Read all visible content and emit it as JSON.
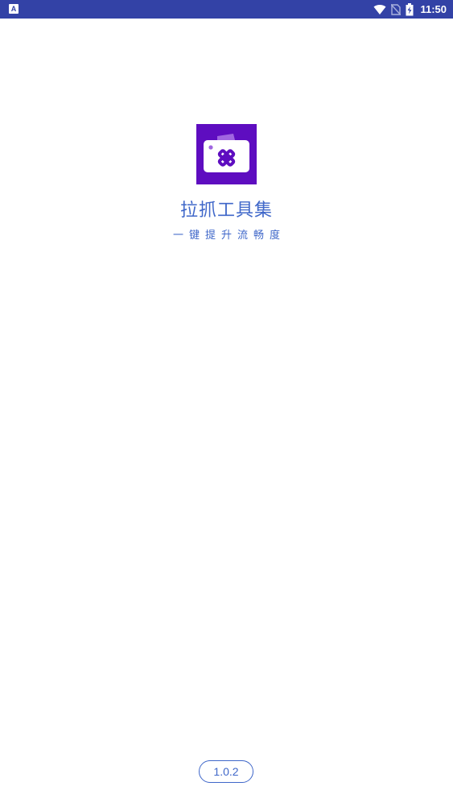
{
  "status_bar": {
    "notification_icon": "A",
    "icons": [
      "wifi-icon",
      "no-sim-icon",
      "battery-charging-icon"
    ],
    "time": "11:50",
    "background_color": "#3342a6"
  },
  "splash": {
    "logo_icon": "app-logo-icon",
    "logo_color": "#5e0dc0",
    "app_name": "拉抓工具集",
    "slogan": "一键提升流畅度",
    "accent_color": "#3f67c9"
  },
  "footer": {
    "version": "1.0.2"
  }
}
